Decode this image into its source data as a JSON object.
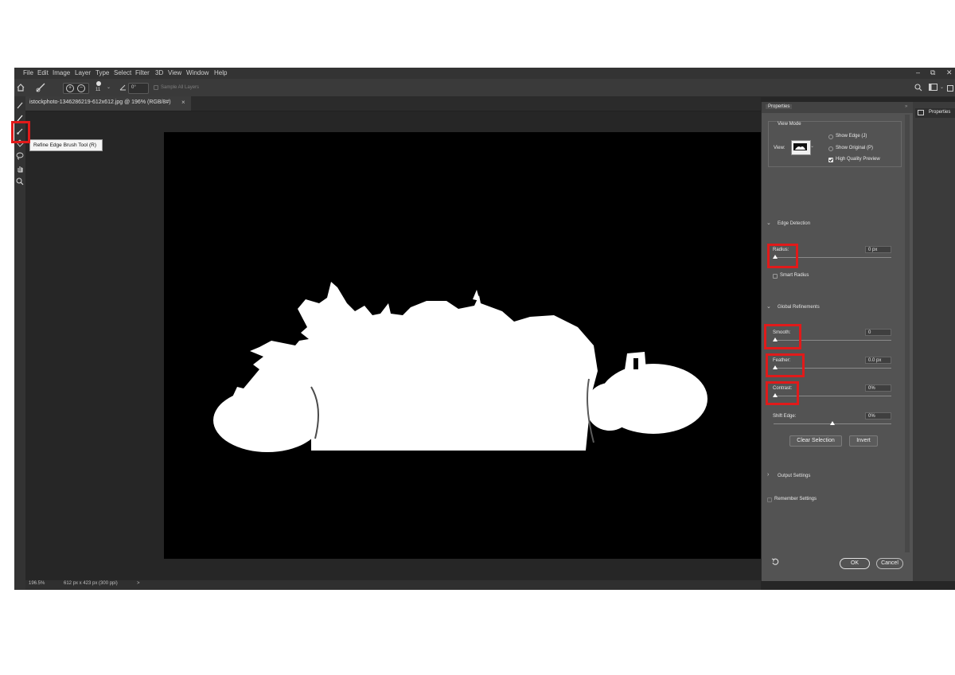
{
  "menubar": {
    "items": [
      "File",
      "Edit",
      "Image",
      "Layer",
      "Type",
      "Select",
      "Filter",
      "3D",
      "View",
      "Window",
      "Help"
    ]
  },
  "options_bar": {
    "brush_size": "11",
    "angle": "0°",
    "sample_all_layers": "Sample All Layers"
  },
  "document": {
    "tab_title": "istockphoto-1346286219-612x612.jpg @ 196% (RGB/8#)",
    "close_glyph": "×"
  },
  "tooltip": {
    "text": "Refine Edge Brush Tool (R)"
  },
  "status_bar": {
    "zoom": "196.5%",
    "doc_info": "612 px x 423 px (300 ppi)",
    "arrow": ">"
  },
  "properties": {
    "tab_title": "Properties",
    "view_mode": {
      "heading": "View Mode",
      "view_label": "View:",
      "show_edge": "Show Edge (J)",
      "show_original": "Show Original (P)",
      "high_quality_preview": "High Quality Preview",
      "high_quality_checked": true
    },
    "edge_detection": {
      "heading": "Edge Detection",
      "radius_label": "Radius:",
      "radius_value": "0 px",
      "smart_radius": "Smart Radius"
    },
    "global_refinements": {
      "heading": "Global Refinements",
      "smooth_label": "Smooth:",
      "smooth_value": "0",
      "feather_label": "Feather:",
      "feather_value": "0.0 px",
      "contrast_label": "Contrast:",
      "contrast_value": "0%",
      "shift_edge_label": "Shift Edge:",
      "shift_edge_value": "0%"
    },
    "buttons": {
      "clear_selection": "Clear Selection",
      "invert": "Invert",
      "ok": "OK",
      "cancel": "Cancel"
    },
    "output_settings": "Output Settings",
    "remember_settings": "Remember Settings"
  },
  "right_rail": {
    "panel_label": "Properties"
  },
  "colors": {
    "highlight": "#e11a1a",
    "panel": "#535353",
    "canvas": "#000000",
    "mask": "#ffffff"
  }
}
